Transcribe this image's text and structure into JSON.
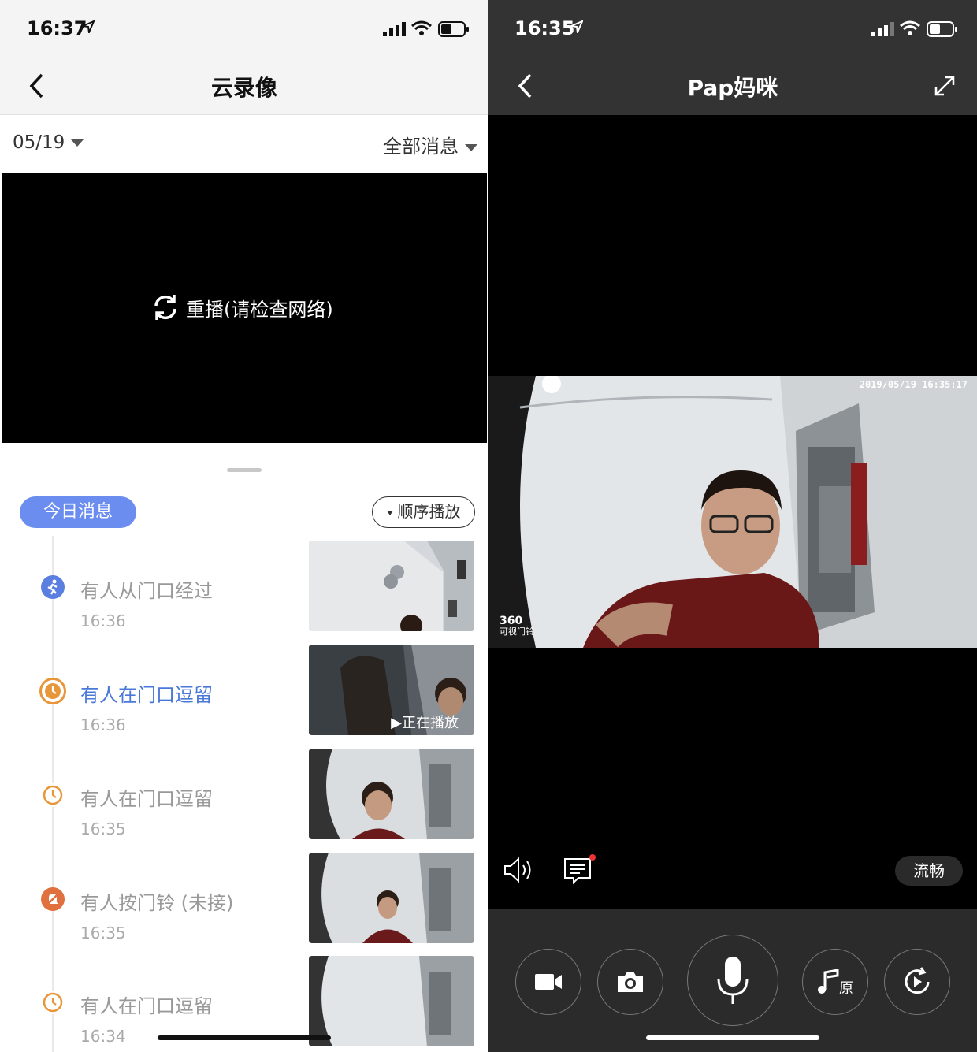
{
  "left": {
    "status": {
      "time": "16:37"
    },
    "nav": {
      "title": "云录像"
    },
    "filter": {
      "date": "05/19",
      "category": "全部消息"
    },
    "player": {
      "replay_label": "重播(请检查网络)"
    },
    "today_label": "今日消息",
    "order_label": "顺序播放",
    "events": [
      {
        "title": "有人从门口经过",
        "time": "16:36",
        "icon": "walking-person-icon",
        "color": "#5b7fe0"
      },
      {
        "title": "有人在门口逗留",
        "time": "16:36",
        "icon": "clock-icon",
        "color": "#e8963a",
        "active": true,
        "playing_label": "▶正在播放"
      },
      {
        "title": "有人在门口逗留",
        "time": "16:35",
        "icon": "clock-icon",
        "color": "#e8963a"
      },
      {
        "title": "有人按门铃 (未接)",
        "time": "16:35",
        "icon": "missed-bell-icon",
        "color": "#e0713f"
      },
      {
        "title": "有人在门口逗留",
        "time": "16:34",
        "icon": "clock-icon",
        "color": "#e8963a"
      }
    ]
  },
  "right": {
    "status": {
      "time": "16:35"
    },
    "nav": {
      "title": "Pap妈咪"
    },
    "video": {
      "timestamp": "2019/05/19  16:35:17",
      "logo_main": "360",
      "logo_sub": "可视门铃"
    },
    "quality_label": "流畅",
    "controls": [
      "record-video-icon",
      "snapshot-icon",
      "microphone-icon",
      "voice-change-icon",
      "playback-icon"
    ],
    "voice_change_label": "原"
  }
}
